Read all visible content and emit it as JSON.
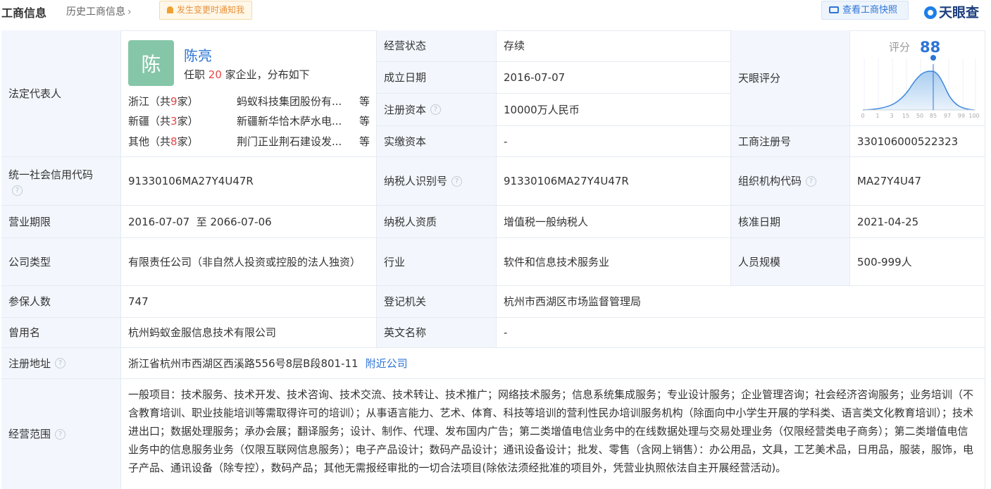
{
  "header": {
    "title": "工商信息",
    "history": "历史工商信息",
    "notify_button": "发生变更时通知我",
    "snapshot_button": "查看工商快照",
    "logo_text": "天眼查"
  },
  "legal_rep": {
    "label": "法定代表人",
    "avatar_char": "陈",
    "name": "陈亮",
    "line_prefix": "任职",
    "count": "20",
    "line_suffix": "家企业，分布如下",
    "rows": [
      {
        "region": "浙江（共",
        "n": "9",
        "tail": "家）",
        "company": "蚂蚁科技集团股份有...",
        "more": "等"
      },
      {
        "region": "新疆（共",
        "n": "3",
        "tail": "家）",
        "company": "新疆新华恰木萨水电...",
        "more": "等"
      },
      {
        "region": "其他（共",
        "n": "8",
        "tail": "家）",
        "company": "荆门正业荆石建设发...",
        "more": "等"
      }
    ]
  },
  "score": {
    "label": "天眼评分",
    "score_label": "评分",
    "score_value": "88",
    "axis": [
      "0",
      "1",
      "3",
      "15",
      "50",
      "85",
      "97",
      "99",
      "100"
    ]
  },
  "fields": {
    "status_label": "经营状态",
    "status_value": "存续",
    "est_label": "成立日期",
    "est_value": "2016-07-07",
    "reg_cap_label": "注册资本",
    "reg_cap_value": "10000万人民币",
    "paid_cap_label": "实缴资本",
    "paid_cap_value": "-",
    "reg_no_label": "工商注册号",
    "reg_no_value": "330106000522323",
    "credit_label": "统一社会信用代码",
    "credit_value": "91330106MA27Y4U47R",
    "tax_label": "纳税人识别号",
    "tax_value": "91330106MA27Y4U47R",
    "org_label": "组织机构代码",
    "org_value": "MA27Y4U47",
    "term_label": "营业期限",
    "term_value": "2016-07-07  至 2066-07-06",
    "taxq_label": "纳税人资质",
    "taxq_value": "增值税一般纳税人",
    "approve_label": "核准日期",
    "approve_value": "2021-04-25",
    "type_label": "公司类型",
    "type_value": "有限责任公司（非自然人投资或控股的法人独资）",
    "industry_label": "行业",
    "industry_value": "软件和信息技术服务业",
    "staff_label": "人员规模",
    "staff_value": "500-999人",
    "insured_label": "参保人数",
    "insured_value": "747",
    "authority_label": "登记机关",
    "authority_value": "杭州市西湖区市场监督管理局",
    "former_label": "曾用名",
    "former_value": "杭州蚂蚁金服信息技术有限公司",
    "english_label": "英文名称",
    "english_value": "-",
    "addr_label": "注册地址",
    "addr_value": "浙江省杭州市西湖区西溪路556号8层B段801-11",
    "addr_link": "附近公司",
    "scope_label": "经营范围",
    "scope_value": "一般项目：技术服务、技术开发、技术咨询、技术交流、技术转让、技术推广；网络技术服务；信息系统集成服务；专业设计服务；企业管理咨询；社会经济咨询服务；业务培训（不含教育培训、职业技能培训等需取得许可的培训）；从事语言能力、艺术、体育、科技等培训的营利性民办培训服务机构（除面向中小学生开展的学科类、语言类文化教育培训）；技术进出口；数据处理服务；承办会展；翻译服务；设计、制作、代理、发布国内广告；第二类增值电信业务中的在线数据处理与交易处理业务（仅限经营类电子商务）；第二类增值电信业务中的信息服务业务（仅限互联网信息服务）；电子产品设计；数码产品设计；通讯设备设计；批发、零售（含网上销售）：办公用品，文具，工艺美术品，日用品，服装，服饰，电子产品、通讯设备（除专控），数码产品；其他无需报经审批的一切合法项目(除依法须经批准的项目外，凭营业执照依法自主开展经营活动)。"
  }
}
